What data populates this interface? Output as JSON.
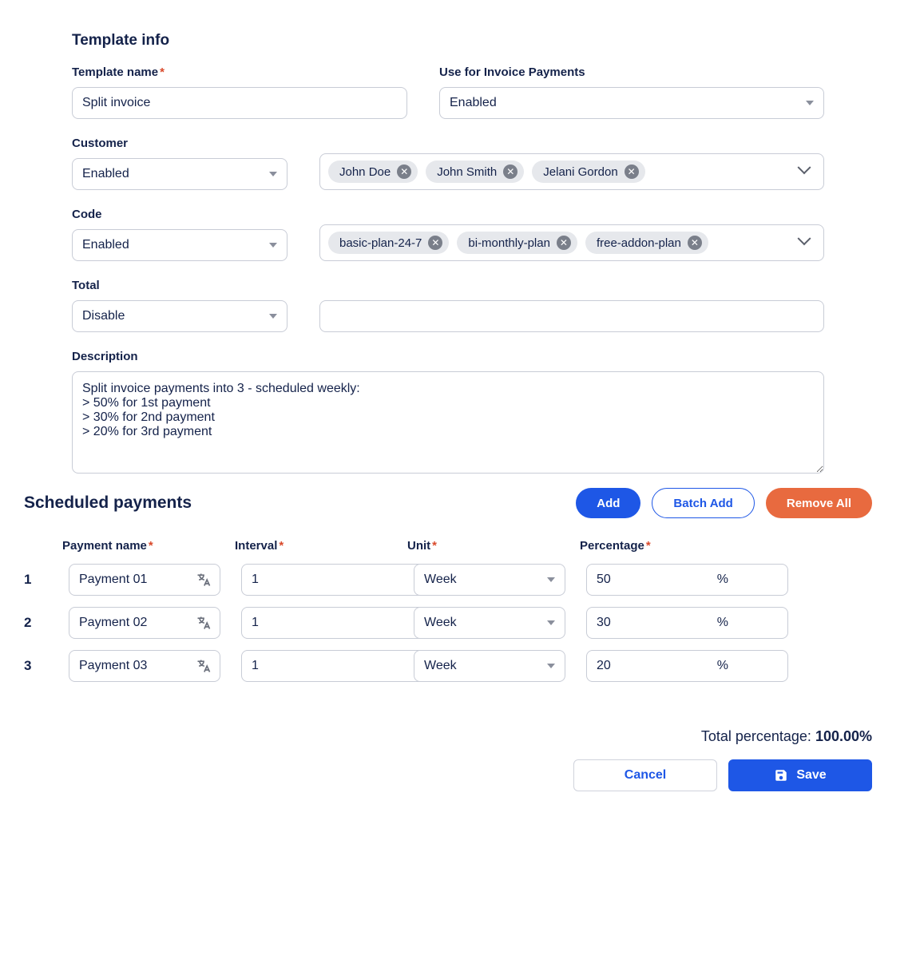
{
  "templateInfo": {
    "title": "Template info",
    "fields": {
      "templateName": {
        "label": "Template name",
        "value": "Split invoice"
      },
      "invoicePayments": {
        "label": "Use for Invoice Payments",
        "value": "Enabled"
      },
      "customer": {
        "label": "Customer",
        "select": "Enabled",
        "chips": [
          "John Doe",
          "John Smith",
          "Jelani Gordon"
        ]
      },
      "code": {
        "label": "Code",
        "select": "Enabled",
        "chips": [
          "basic-plan-24-7",
          "bi-monthly-plan",
          "free-addon-plan"
        ]
      },
      "total": {
        "label": "Total",
        "select": "Disable",
        "value": ""
      },
      "description": {
        "label": "Description",
        "value": "Split invoice payments into 3 - scheduled weekly:\n> 50% for 1st payment\n> 30% for 2nd payment\n> 20% for 3rd payment"
      }
    }
  },
  "scheduled": {
    "title": "Scheduled payments",
    "buttons": {
      "add": "Add",
      "batchAdd": "Batch Add",
      "removeAll": "Remove All"
    },
    "headers": {
      "name": "Payment name",
      "interval": "Interval",
      "unit": "Unit",
      "percentage": "Percentage"
    },
    "rows": [
      {
        "idx": "1",
        "name": "Payment 01",
        "interval": "1",
        "unit": "Week",
        "percentage": "50"
      },
      {
        "idx": "2",
        "name": "Payment 02",
        "interval": "1",
        "unit": "Week",
        "percentage": "30"
      },
      {
        "idx": "3",
        "name": "Payment 03",
        "interval": "1",
        "unit": "Week",
        "percentage": "20"
      }
    ],
    "percentSymbol": "%"
  },
  "totals": {
    "label": "Total percentage:",
    "value": "100.00%"
  },
  "footer": {
    "cancel": "Cancel",
    "save": "Save"
  }
}
